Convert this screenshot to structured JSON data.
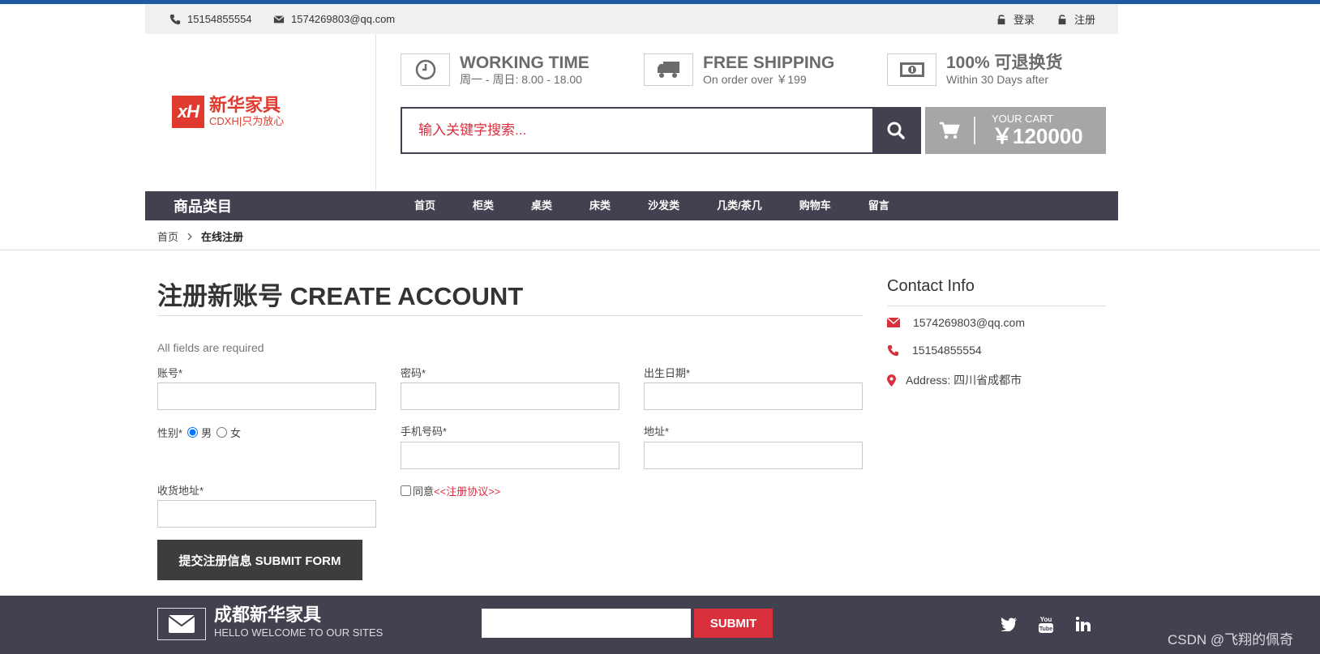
{
  "topbar": {
    "phone": "15154855554",
    "email": "1574269803@qq.com",
    "login": "登录",
    "register": "注册"
  },
  "logo": {
    "mark": "xH",
    "name": "新华家具",
    "slogan": "CDXH|只为放心"
  },
  "features": [
    {
      "title": "WORKING TIME",
      "sub": "周一 - 周日: 8.00 - 18.00",
      "icon": "clock-icon"
    },
    {
      "title": "FREE SHIPPING",
      "sub": "On order over ￥199",
      "icon": "truck-icon"
    },
    {
      "title": "100% 可退换货",
      "sub": "Within 30 Days after",
      "icon": "money-icon"
    }
  ],
  "search": {
    "placeholder": "输入关键字搜索..."
  },
  "cart": {
    "label": "YOUR CART",
    "total": "￥120000"
  },
  "nav": {
    "category": "商品类目",
    "items": [
      "首页",
      "柜类",
      "桌类",
      "床类",
      "沙发类",
      "几类/茶几",
      "购物车",
      "留言"
    ]
  },
  "breadcrumb": {
    "home": "首页",
    "current": "在线注册"
  },
  "form": {
    "title": "注册新账号 CREATE ACCOUNT",
    "note": "All fields are required",
    "account_label": "账号*",
    "password_label": "密码*",
    "birthday_label": "出生日期*",
    "gender_label": "性别*",
    "male": "男",
    "female": "女",
    "mobile_label": "手机号码*",
    "address_label": "地址*",
    "shipping_label": "收货地址*",
    "agree_text": "同意",
    "protocol": "<<注册协议>>",
    "submit": "提交注册信息 SUBMIT FORM"
  },
  "contact": {
    "title": "Contact Info",
    "email": "1574269803@qq.com",
    "phone": "15154855554",
    "address": "Address: 四川省成都市"
  },
  "footer": {
    "brand": "成都新华家具",
    "sub": "HELLO WELCOME TO OUR SITES",
    "submit": "SUBMIT",
    "social": [
      "twitter-icon",
      "youtube-icon",
      "linkedin-icon"
    ]
  },
  "watermark": "CSDN @飞翔的佩奇",
  "colors": {
    "nav": "#41414f",
    "accent": "#d93040",
    "topline": "#1e5aa0"
  }
}
